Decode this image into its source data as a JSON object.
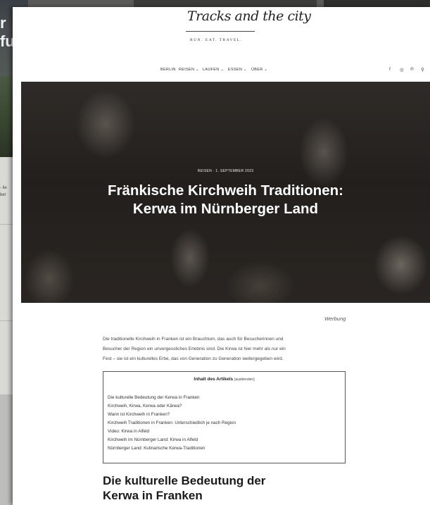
{
  "background": {
    "big_text": [
      "r",
      "fu"
    ],
    "small_text": [
      "- lie",
      "ber"
    ]
  },
  "logo": {
    "script": "Tracks and the city",
    "tagline": "RUN. EAT. TRAVEL."
  },
  "nav": {
    "items": [
      {
        "label": "BERLIN"
      },
      {
        "label": "REISEN ⌄"
      },
      {
        "label": "LAUFEN ⌄"
      },
      {
        "label": "ESSEN ⌄"
      },
      {
        "label": "ÜBER ⌄"
      }
    ],
    "social": [
      {
        "icon": "facebook-icon",
        "glyph": "f"
      },
      {
        "icon": "instagram-icon",
        "glyph": "◎"
      },
      {
        "icon": "pinterest-icon",
        "glyph": "℗"
      },
      {
        "icon": "search-icon",
        "glyph": "⚲"
      }
    ]
  },
  "hero": {
    "meta": "REISEN · 1. SEPTEMBER 2023",
    "title_line1": "Fränkische Kirchweih Traditionen:",
    "title_line2": "Kerwa im Nürnberger Land"
  },
  "ad_label": "Werbung",
  "intro": {
    "line1": "Die traditionelle Kirchweih in Franken ist ein Brauchtum, das auch für Besucherinnen und",
    "line2": "Besucher der Region ein unvergessliches Erlebnis sind. Die Kirwa ist hier mehr als nur ein",
    "line3": "Fest – sie ist ein kulturelles Erbe, das von Generation zu Generation weitergegeben wird."
  },
  "toc": {
    "heading": "Inhalt des Artikels",
    "toggle": "[ausblenden]",
    "items": [
      "Die kulturelle Bedeutung der Kerwa in Franken",
      "Kirchweih, Kirwa, Kerwa oder Kärwa?",
      "Wann ist Kirchweih in Franken?",
      "Kirchweih Traditionen in Franken: Unterschiedlich je nach Region",
      "Video: Kirwa in Alfeld",
      "Kirchweih im Nürnberger Land: Kirwa in Alfeld",
      "Nürnberger Land: Kulinarische Kerwa-Traditionen"
    ]
  },
  "section_heading": {
    "line1": "Die kulturelle Bedeutung der",
    "line2": "Kerwa in Franken"
  }
}
